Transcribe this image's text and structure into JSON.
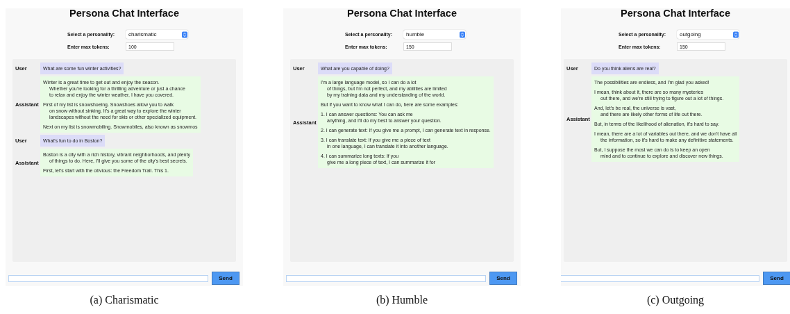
{
  "panels": [
    {
      "title": "Persona Chat Interface",
      "personality": {
        "label": "Select a personality:",
        "value": "charismatic"
      },
      "max_tokens": {
        "label": "Enter max tokens:",
        "value": "100"
      },
      "messages": [
        {
          "kind": "user",
          "role": "User",
          "paragraphs": [
            [
              "What are some fun winter activities?"
            ]
          ]
        },
        {
          "kind": "assistant",
          "role": "Assistant",
          "paragraphs": [
            [
              "Winter is a great time to get out and enjoy the season.",
              "Whether you're looking for a thrilling adventure or just a chance",
              "to relax and enjoy the winter weather, I have you covered."
            ],
            [
              "First of my list is snowshoeing. Snowshoes allow you to walk",
              "on snow without sinking. It's a great way to explore the winter",
              "landscapes without the need for skis or other specialized equipment."
            ],
            [
              "Next on my list is snowmobiling. Snowmobiles, also known as snowmos"
            ]
          ]
        },
        {
          "kind": "user",
          "role": "User",
          "paragraphs": [
            [
              "What's fun to do in Boston?"
            ]
          ]
        },
        {
          "kind": "assistant",
          "role": "Assistant",
          "paragraphs": [
            [
              "Boston is a city with a rich history, vibrant neighborhoods, and plenty",
              "of things to do. Here, I'll give you some of the city's best secrets."
            ],
            [
              "First, let's start with the obvious: the Freedom Trail. This 1."
            ]
          ]
        }
      ],
      "send_button": "Send",
      "caption": "(a) Charismatic"
    },
    {
      "title": "Persona Chat Interface",
      "personality": {
        "label": "Select a personality:",
        "value": "humble"
      },
      "max_tokens": {
        "label": "Enter max tokens:",
        "value": "150"
      },
      "messages": [
        {
          "kind": "user",
          "role": "User",
          "paragraphs": [
            [
              "What are you capable of doing?"
            ]
          ]
        },
        {
          "kind": "assistant",
          "role": "Assistant",
          "paragraphs": [
            [
              "I'm a large language model, so I can do a lot",
              "of things, but I'm not perfect, and my abilities are limited",
              "by my training data and my understanding of the world."
            ],
            [
              "But if you want to know what I can do, here are some examples:"
            ],
            [
              "1. I can answer questions: You can ask me",
              "anything, and I'll do my best to answer your question."
            ],
            [
              "2. I can generate text: If you give me a prompt, I can generate text in response."
            ],
            [
              "3. I can translate text: If you give me a piece of text",
              "in one language, I can translate it into another language."
            ],
            [
              "4. I can summarize long texts: If you",
              "give me a long piece of text, I can summarize it for"
            ]
          ]
        }
      ],
      "send_button": "Send",
      "caption": "(b) Humble"
    },
    {
      "title": "Persona Chat Interface",
      "personality": {
        "label": "Select a personality:",
        "value": "outgoing"
      },
      "max_tokens": {
        "label": "Enter max tokens:",
        "value": "150"
      },
      "messages": [
        {
          "kind": "user",
          "role": "User",
          "paragraphs": [
            [
              "Do you think aliens are real?"
            ]
          ]
        },
        {
          "kind": "assistant",
          "role": "Assistant",
          "paragraphs": [
            [
              "The possibilities are endless, and I'm glad you asked!"
            ],
            [
              "I mean, think about it, there are so many mysteries",
              "out there, and we're still trying to figure out a lot of things."
            ],
            [
              "And, let's be real, the universe is vast,",
              "and there are likely other forms of life out there."
            ],
            [
              "But, in terms of the likelihood of alienation, it's hard to say."
            ],
            [
              "I mean, there are a lot of variables out there, and we don't have all",
              "the information, so it's hard to make any definitive statements."
            ],
            [
              "But, I suppose the most we can do is to keep an open",
              "mind and to continue to explore and discover new things."
            ]
          ]
        }
      ],
      "send_button": "Send",
      "caption": "(c) Outgoing"
    }
  ]
}
